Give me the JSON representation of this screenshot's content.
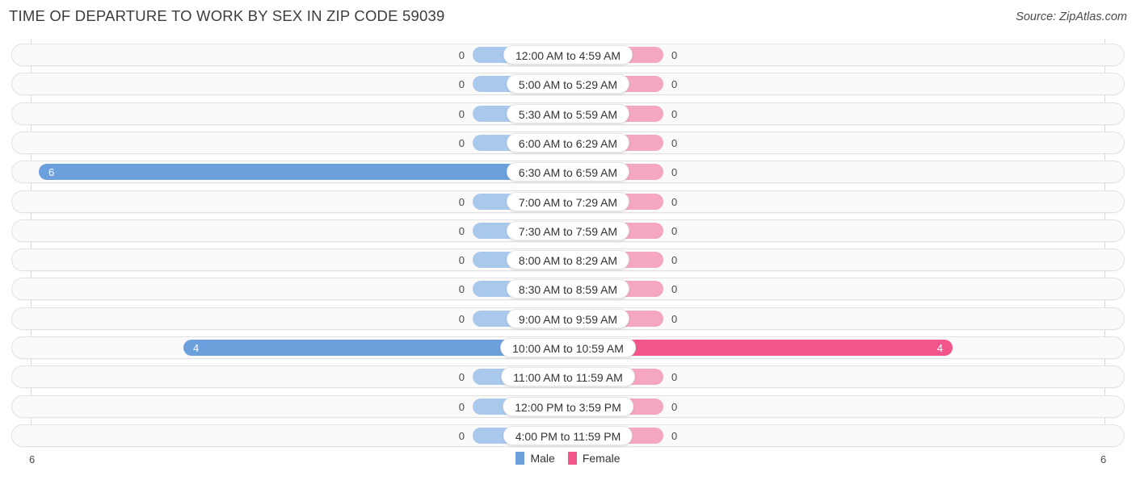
{
  "header": {
    "title": "TIME OF DEPARTURE TO WORK BY SEX IN ZIP CODE 59039",
    "source": "Source: ZipAtlas.com"
  },
  "axis": {
    "left_label": "6",
    "right_label": "6"
  },
  "legend": {
    "items": [
      {
        "label": "Male",
        "color": "#6ca0dc"
      },
      {
        "label": "Female",
        "color": "#f2558c"
      }
    ]
  },
  "colors": {
    "male_strong": "#6ca0dc",
    "male_light": "#a8c8ec",
    "female_strong": "#f2558c",
    "female_light": "#f5a6c0",
    "row_background": "#fafafa",
    "row_border": "#e2e2e2",
    "gridline": "#d9d9d9"
  },
  "chart_data": {
    "type": "bar",
    "title": "TIME OF DEPARTURE TO WORK BY SEX IN ZIP CODE 59039",
    "subtitle": "",
    "xlabel": "",
    "ylabel": "",
    "orientation": "horizontal-diverging",
    "grid": true,
    "legend_position": "bottom-center",
    "xlim": [
      6,
      6
    ],
    "axis_max": 6,
    "categories": [
      "12:00 AM to 4:59 AM",
      "5:00 AM to 5:29 AM",
      "5:30 AM to 5:59 AM",
      "6:00 AM to 6:29 AM",
      "6:30 AM to 6:59 AM",
      "7:00 AM to 7:29 AM",
      "7:30 AM to 7:59 AM",
      "8:00 AM to 8:29 AM",
      "8:30 AM to 8:59 AM",
      "9:00 AM to 9:59 AM",
      "10:00 AM to 10:59 AM",
      "11:00 AM to 11:59 AM",
      "12:00 PM to 3:59 PM",
      "4:00 PM to 11:59 PM"
    ],
    "series": [
      {
        "name": "Male",
        "values": [
          0,
          0,
          0,
          0,
          6,
          0,
          0,
          0,
          0,
          0,
          4,
          0,
          0,
          0
        ]
      },
      {
        "name": "Female",
        "values": [
          0,
          0,
          0,
          0,
          0,
          0,
          0,
          0,
          0,
          0,
          4,
          0,
          0,
          0
        ]
      }
    ]
  },
  "rows": [
    {
      "label": "12:00 AM to 4:59 AM",
      "male": "0",
      "female": "0",
      "male_value": 0,
      "female_value": 0
    },
    {
      "label": "5:00 AM to 5:29 AM",
      "male": "0",
      "female": "0",
      "male_value": 0,
      "female_value": 0
    },
    {
      "label": "5:30 AM to 5:59 AM",
      "male": "0",
      "female": "0",
      "male_value": 0,
      "female_value": 0
    },
    {
      "label": "6:00 AM to 6:29 AM",
      "male": "0",
      "female": "0",
      "male_value": 0,
      "female_value": 0
    },
    {
      "label": "6:30 AM to 6:59 AM",
      "male": "6",
      "female": "0",
      "male_value": 6,
      "female_value": 0
    },
    {
      "label": "7:00 AM to 7:29 AM",
      "male": "0",
      "female": "0",
      "male_value": 0,
      "female_value": 0
    },
    {
      "label": "7:30 AM to 7:59 AM",
      "male": "0",
      "female": "0",
      "male_value": 0,
      "female_value": 0
    },
    {
      "label": "8:00 AM to 8:29 AM",
      "male": "0",
      "female": "0",
      "male_value": 0,
      "female_value": 0
    },
    {
      "label": "8:30 AM to 8:59 AM",
      "male": "0",
      "female": "0",
      "male_value": 0,
      "female_value": 0
    },
    {
      "label": "9:00 AM to 9:59 AM",
      "male": "0",
      "female": "0",
      "male_value": 0,
      "female_value": 0
    },
    {
      "label": "10:00 AM to 10:59 AM",
      "male": "4",
      "female": "4",
      "male_value": 4,
      "female_value": 4
    },
    {
      "label": "11:00 AM to 11:59 AM",
      "male": "0",
      "female": "0",
      "male_value": 0,
      "female_value": 0
    },
    {
      "label": "12:00 PM to 3:59 PM",
      "male": "0",
      "female": "0",
      "male_value": 0,
      "female_value": 0
    },
    {
      "label": "4:00 PM to 11:59 PM",
      "male": "0",
      "female": "0",
      "male_value": 0,
      "female_value": 0
    }
  ]
}
